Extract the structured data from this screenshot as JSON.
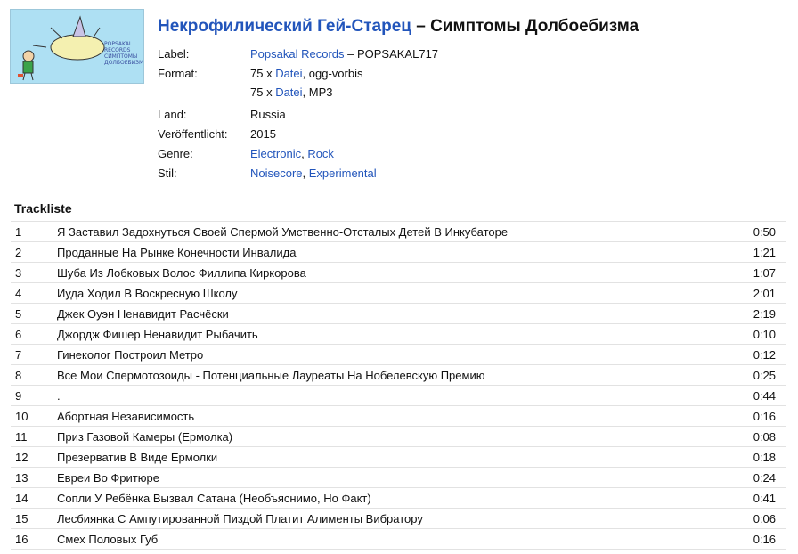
{
  "release": {
    "artist": "Некрофилический Гей-Старец",
    "separator": "–",
    "title": "Симптомы Долбоебизма"
  },
  "meta": {
    "label_label": "Label:",
    "label_link": "Popsakal Records",
    "label_sep": " – ",
    "catalog": "POPSAKAL717",
    "format_label": "Format:",
    "format": [
      {
        "count": "75 x ",
        "link": "Datei",
        "rest": ", ogg-vorbis"
      },
      {
        "count": "75 x ",
        "link": "Datei",
        "rest": ", MP3"
      }
    ],
    "country_label": "Land:",
    "country": "Russia",
    "released_label": "Veröffentlicht:",
    "released": "2015",
    "genre_label": "Genre:",
    "genres": [
      "Electronic",
      "Rock"
    ],
    "style_label": "Stil:",
    "styles": [
      "Noisecore",
      "Experimental"
    ],
    "list_sep": ", "
  },
  "cover": {
    "text": "POPSAKAL RECORDS СИМПТОМЫ ДОЛБОЕБИЗМА"
  },
  "tracklist": {
    "heading": "Trackliste",
    "tracks": [
      {
        "pos": "1",
        "title": "Я Заставил Задохнуться Своей Спермой Умственно-Отсталых Детей В Инкубаторе",
        "duration": "0:50"
      },
      {
        "pos": "2",
        "title": "Проданные На Рынке Конечности Инвалида",
        "duration": "1:21"
      },
      {
        "pos": "3",
        "title": "Шуба Из Лобковых Волос Филлипа Киркорова",
        "duration": "1:07"
      },
      {
        "pos": "4",
        "title": "Иуда Ходил В Воскресную Школу",
        "duration": "2:01"
      },
      {
        "pos": "5",
        "title": "Джек Оуэн Ненавидит Расчёски",
        "duration": "2:19"
      },
      {
        "pos": "6",
        "title": "Джордж Фишер Ненавидит Рыбачить",
        "duration": "0:10"
      },
      {
        "pos": "7",
        "title": "Гинеколог Построил Метро",
        "duration": "0:12"
      },
      {
        "pos": "8",
        "title": "Все Мои Спермотозоиды - Потенциальные Лауреаты На Нобелевскую Премию",
        "duration": "0:25"
      },
      {
        "pos": "9",
        "title": ".",
        "duration": "0:44"
      },
      {
        "pos": "10",
        "title": "Абортная Независимость",
        "duration": "0:16"
      },
      {
        "pos": "11",
        "title": "Приз Газовой Камеры (Ермолка)",
        "duration": "0:08"
      },
      {
        "pos": "12",
        "title": "Презерватив В Виде Ермолки",
        "duration": "0:18"
      },
      {
        "pos": "13",
        "title": "Евреи Во Фритюре",
        "duration": "0:24"
      },
      {
        "pos": "14",
        "title": "Сопли У Ребёнка Вызвал Сатана (Необъяснимо, Но Факт)",
        "duration": "0:41"
      },
      {
        "pos": "15",
        "title": "Лесбиянка С Ампутированной Пиздой Платит Алименты Вибратору",
        "duration": "0:06"
      },
      {
        "pos": "16",
        "title": "Смех Половых Губ",
        "duration": "0:16"
      }
    ]
  }
}
